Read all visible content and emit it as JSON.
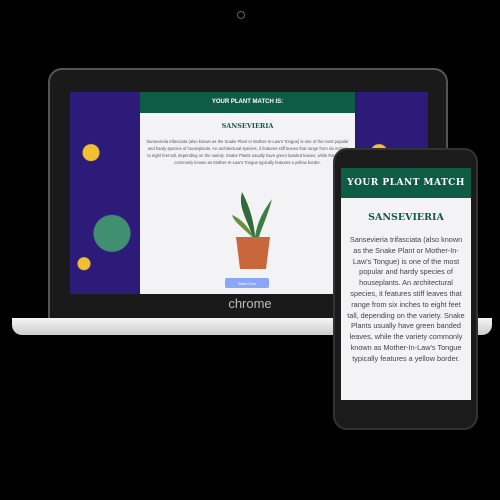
{
  "laptop": {
    "header": "YOUR PLANT MATCH IS:",
    "plant_name": "SANSEVIERIA",
    "description": "Sansevieria trifasciata (also known as the Snake Plant or Mother-In-Law's Tongue) is one of the most popular and hardy species of houseplants. An architectural species, it features stiff leaves that range from six inches to eight feet tall, depending on the variety. Snake Plants usually have green banded leaves, while the variety commonly known as Mother-In-Law's Tongue typically features a yellow border.",
    "button_label": "Start Over",
    "brand": "chrome"
  },
  "phone": {
    "header": "YOUR PLANT MATCH IS:",
    "plant_name": "SANSEVIERIA",
    "description": "Sansevieria trifasciata (also known as the Snake Plant or Mother-In-Law's Tongue) is one of the most popular and hardy species of houseplants. An architectural species, it features stiff leaves that range from six inches to eight feet tall, depending on the variety. Snake Plants usually have green banded leaves, while the variety commonly known as Mother-In-Law's Tongue typically features a yellow border."
  },
  "colors": {
    "header": "#0f5c45",
    "button": "#8aa6f6"
  }
}
